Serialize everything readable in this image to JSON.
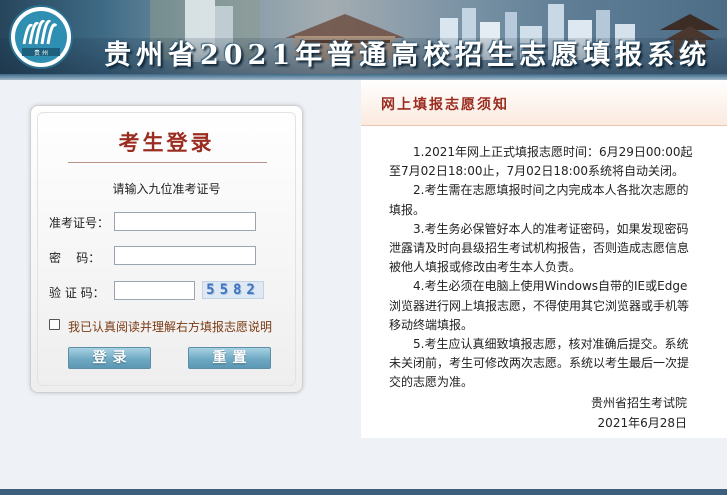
{
  "banner": {
    "title": "贵州省2021年普通高校招生志愿填报系统",
    "logo_icon": "ministry-logo-icon"
  },
  "login": {
    "title": "考生登录",
    "hint": "请输入九位准考证号",
    "exam_no_label": "准考证号：",
    "password_label": "密    码：",
    "captcha_label": "验 证 码：",
    "captcha_text": "5582",
    "exam_no_value": "",
    "password_value": "",
    "captcha_value": "",
    "agree_text": "我已认真阅读并理解右方填报志愿说明",
    "agree_checked": false,
    "login_button": "登录",
    "reset_button": "重置"
  },
  "notice": {
    "title": "网上填报志愿须知",
    "items": [
      "1.2021年网上正式填报志愿时间：6月29日00:00起至7月02日18:00止，7月02日18:00系统将自动关闭。",
      "2.考生需在志愿填报时间之内完成本人各批次志愿的填报。",
      "3.考生务必保管好本人的准考证密码，如果发现密码泄露请及时向县级招生考试机构报告，否则造成志愿信息被他人填报或修改由考生本人负责。",
      "4.考生必须在电脑上使用Windows自带的IE或Edge浏览器进行网上填报志愿，不得使用其它浏览器或手机等移动终端填报。",
      "5.考生应认真细致填报志愿，核对准确后提交。系统未关闭前，考生可修改两次志愿。系统以考生最后一次提交的志愿为准。"
    ],
    "signature": "贵州省招生考试院",
    "date": "2021年6月28日"
  },
  "colors": {
    "accent_red": "#9b2d20",
    "button_blue": "#6fa9c3",
    "banner_blue": "#3d6988"
  }
}
